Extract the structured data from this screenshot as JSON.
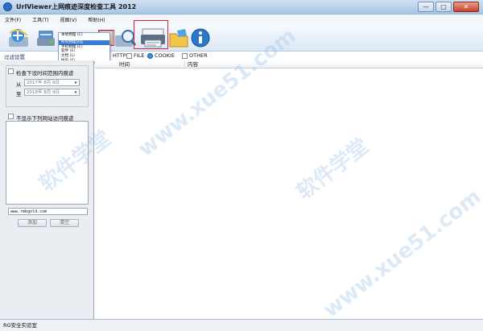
{
  "window": {
    "title": "UrlViewer上网痕迹深度检查工具 2012",
    "min": "—",
    "max": "▢",
    "close": "✕"
  },
  "menu": [
    "文件(F)",
    "工具(T)",
    "视图(V)",
    "帮助(H)"
  ],
  "toolbar": {
    "icons": [
      "ie-browser-icon",
      "network-icon",
      "tools-icon",
      "search-icon",
      "printer-icon",
      "folder-icon",
      "info-icon"
    ]
  },
  "dropdown": {
    "items": [
      "本地物理 (C)",
      "所有物理分区",
      "手机物理 (C)",
      "软件 (E)",
      "文档 (L)",
      "娱乐 (F)"
    ],
    "selected_index": 1
  },
  "filter_label": "过滤设置",
  "tabs": [
    "HTTP",
    "FILE",
    "COOKIE",
    "OTHER"
  ],
  "filter": {
    "time_range_label": "检查下设时间范围内痕迹",
    "from_label": "从",
    "from_date": "2017年 8月 9日",
    "to_label": "至",
    "to_date": "2018年 8月 9日",
    "exclude_label": "不显示下列网站访问痕迹",
    "url_value": "www.rmbgold.com",
    "add_button": "添加",
    "clear_button": "清空"
  },
  "table": {
    "columns": [
      "时间",
      "内容"
    ]
  },
  "status": "RG安全实验室",
  "watermark": [
    "www.xue51.com",
    "软件学堂",
    "www.xue51.com",
    "软件学堂"
  ]
}
